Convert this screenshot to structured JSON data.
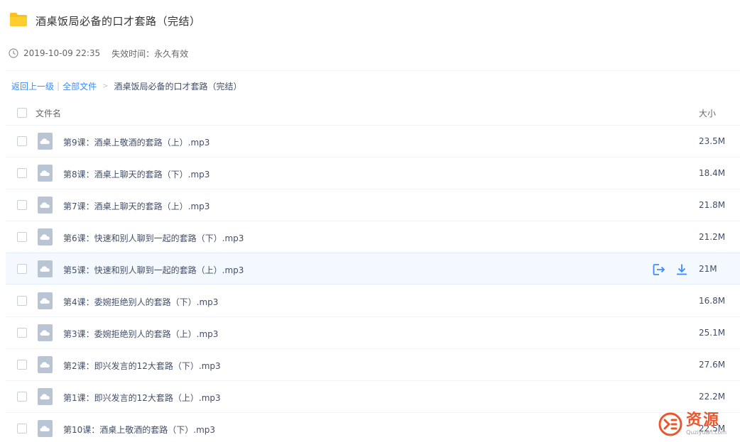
{
  "share": {
    "title": "酒桌饭局必备的口才套路（完结）",
    "time": "2019-10-09 22:35",
    "expiry": "失效时间：永久有效"
  },
  "breadcrumb": {
    "back": "返回上一级",
    "separator": "|",
    "all_files": "全部文件",
    "arrow": ">",
    "current": "酒桌饭局必备的口才套路（完结）"
  },
  "list": {
    "col_name": "文件名",
    "col_size": "大小",
    "rows": [
      {
        "name": "第9课：酒桌上敬酒的套路（上）.mp3",
        "size": "23.5M"
      },
      {
        "name": "第8课：酒桌上聊天的套路（下）.mp3",
        "size": "18.4M"
      },
      {
        "name": "第7课：酒桌上聊天的套路（上）.mp3",
        "size": "21.8M"
      },
      {
        "name": "第6课：快速和别人聊到一起的套路（下）.mp3",
        "size": "21.2M"
      },
      {
        "name": "第5课：快速和别人聊到一起的套路（上）.mp3",
        "size": "21M"
      },
      {
        "name": "第4课：委婉拒绝别人的套路（下）.mp3",
        "size": "16.8M"
      },
      {
        "name": "第3课：委婉拒绝别人的套路（上）.mp3",
        "size": "25.1M"
      },
      {
        "name": "第2课：即兴发言的12大套路（下）.mp3",
        "size": "27.6M"
      },
      {
        "name": "第1课：即兴发言的12大套路（上）.mp3",
        "size": "22.2M"
      },
      {
        "name": "第10课：酒桌上敬酒的套路（下）.mp3",
        "size": "22.5M"
      }
    ]
  },
  "watermark": {
    "cn": "资源",
    "en": "Quziyuan.com"
  },
  "colors": {
    "accent": "#3b8cff",
    "folder": "#ffcd2e",
    "file_icon": "#b9c5d4",
    "watermark": "#e8572e"
  },
  "icons": {
    "folder": "folder-icon",
    "clock": "clock-icon",
    "file": "cloud-file-icon",
    "save": "save-to-disk-icon",
    "download": "download-icon"
  }
}
